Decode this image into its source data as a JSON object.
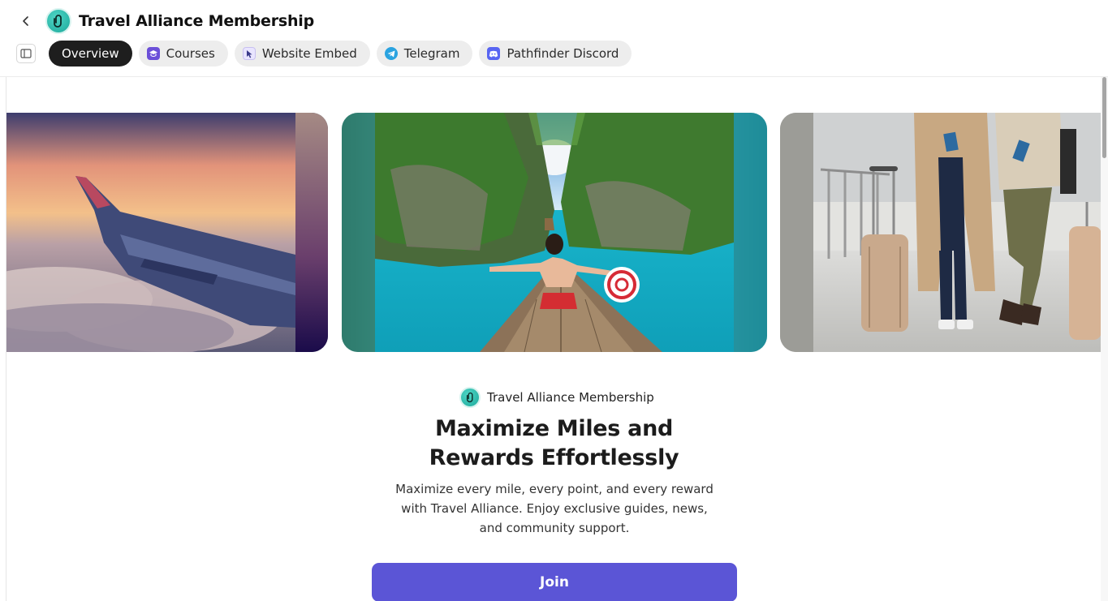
{
  "header": {
    "title": "Travel Alliance Membership",
    "logo_icon": "travel-alliance-logo"
  },
  "tabs": [
    {
      "label": "Overview",
      "icon": "",
      "active": true
    },
    {
      "label": "Courses",
      "icon": "graduation-cap-icon",
      "active": false
    },
    {
      "label": "Website Embed",
      "icon": "cursor-window-icon",
      "active": false
    },
    {
      "label": "Telegram",
      "icon": "telegram-icon",
      "active": false
    },
    {
      "label": "Pathfinder Discord",
      "icon": "discord-icon",
      "active": false
    }
  ],
  "carousel": [
    {
      "subject": "airplane-wing-sunset"
    },
    {
      "subject": "woman-on-boat-turquoise-lagoon"
    },
    {
      "subject": "travelers-with-luggage-airport"
    }
  ],
  "content": {
    "brand_name": "Travel Alliance Membership",
    "headline_line1": "Maximize Miles and",
    "headline_line2": "Rewards Effortlessly",
    "description": "Maximize every mile, every point, and every reward with Travel Alliance. Enjoy exclusive guides, news, and community support.",
    "join_label": "Join"
  },
  "colors": {
    "accent": "#5b55d6",
    "active_tab": "#1e1e1e",
    "tab_bg": "#ededed",
    "logo": "#1ba89a"
  }
}
